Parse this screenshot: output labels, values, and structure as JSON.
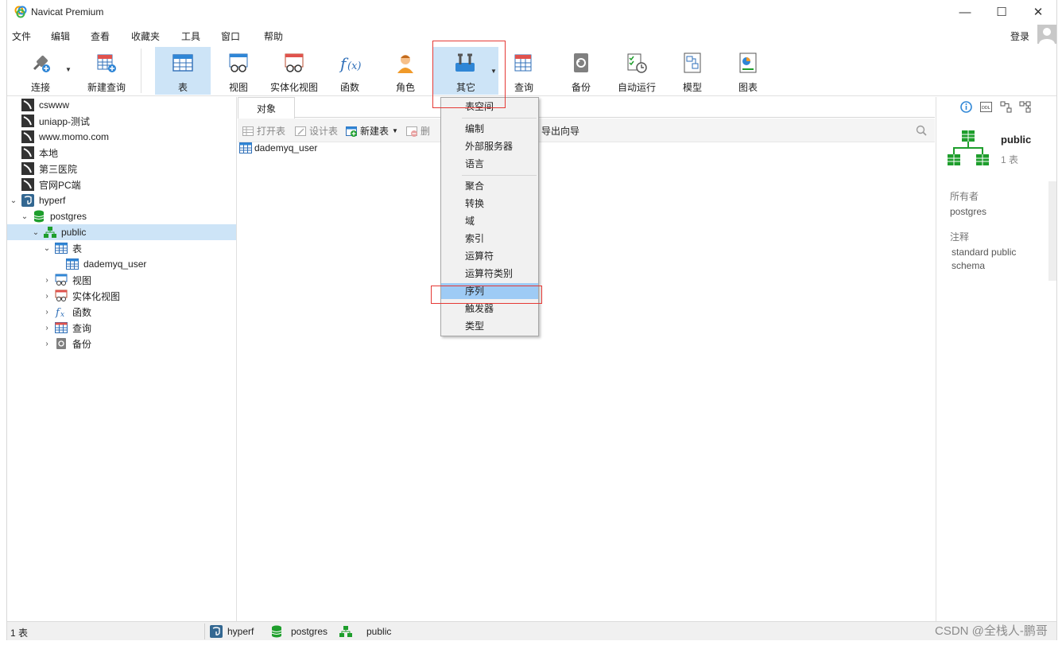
{
  "app": {
    "title": "Navicat Premium"
  },
  "window_controls": {
    "minimize": "—",
    "maximize": "☐",
    "close": "✕"
  },
  "menu": [
    "文件",
    "编辑",
    "查看",
    "收藏夹",
    "工具",
    "窗口",
    "帮助"
  ],
  "account": {
    "login_label": "登录"
  },
  "toolbar": {
    "connect": "连接",
    "new_query": "新建查询",
    "table": "表",
    "view": "视图",
    "materialized_view": "实体化视图",
    "function": "函数",
    "role": "角色",
    "other": "其它",
    "query": "查询",
    "backup": "备份",
    "auto_run": "自动运行",
    "model": "模型",
    "chart": "图表"
  },
  "tree": {
    "connections": [
      "cswww",
      "uniapp-测试",
      "www.momo.com",
      "本地",
      "第三医院",
      "官网PC端"
    ],
    "hyperf": "hyperf",
    "database": "postgres",
    "schema": "public",
    "tables_group": "表",
    "table_item": "dademyq_user",
    "views_group": "视图",
    "matviews_group": "实体化视图",
    "functions_group": "函数",
    "queries_group": "查询",
    "backups_group": "备份"
  },
  "main": {
    "tab_objects": "对象",
    "open_table": "打开表",
    "design_table": "设计表",
    "new_table": "新建表",
    "delete_table": "删",
    "export_wizard": "导出向导",
    "list_item": "dademyq_user"
  },
  "dropdown": {
    "items_group1": [
      "表空间"
    ],
    "items_group2": [
      "编制",
      "外部服务器",
      "语言"
    ],
    "items_group3": [
      "聚合",
      "转换",
      "域",
      "索引",
      "运算符",
      "运算符类别",
      "序列",
      "触发器",
      "类型"
    ],
    "highlighted": "序列"
  },
  "info": {
    "name": "public",
    "count": "1 表",
    "owner_label": "所有者",
    "owner_value": "postgres",
    "comment_label": "注释",
    "comment_value": "standard public schema"
  },
  "status": {
    "count": "1 表",
    "connection": "hyperf",
    "database": "postgres",
    "schema": "public"
  },
  "watermark": "CSDN @全栈人-鹏哥",
  "colors": {
    "selection": "#cde4f7",
    "menu_highlight": "#9ecbf5",
    "annotation_red": "#e53935",
    "schema_green": "#1e9e2c"
  }
}
